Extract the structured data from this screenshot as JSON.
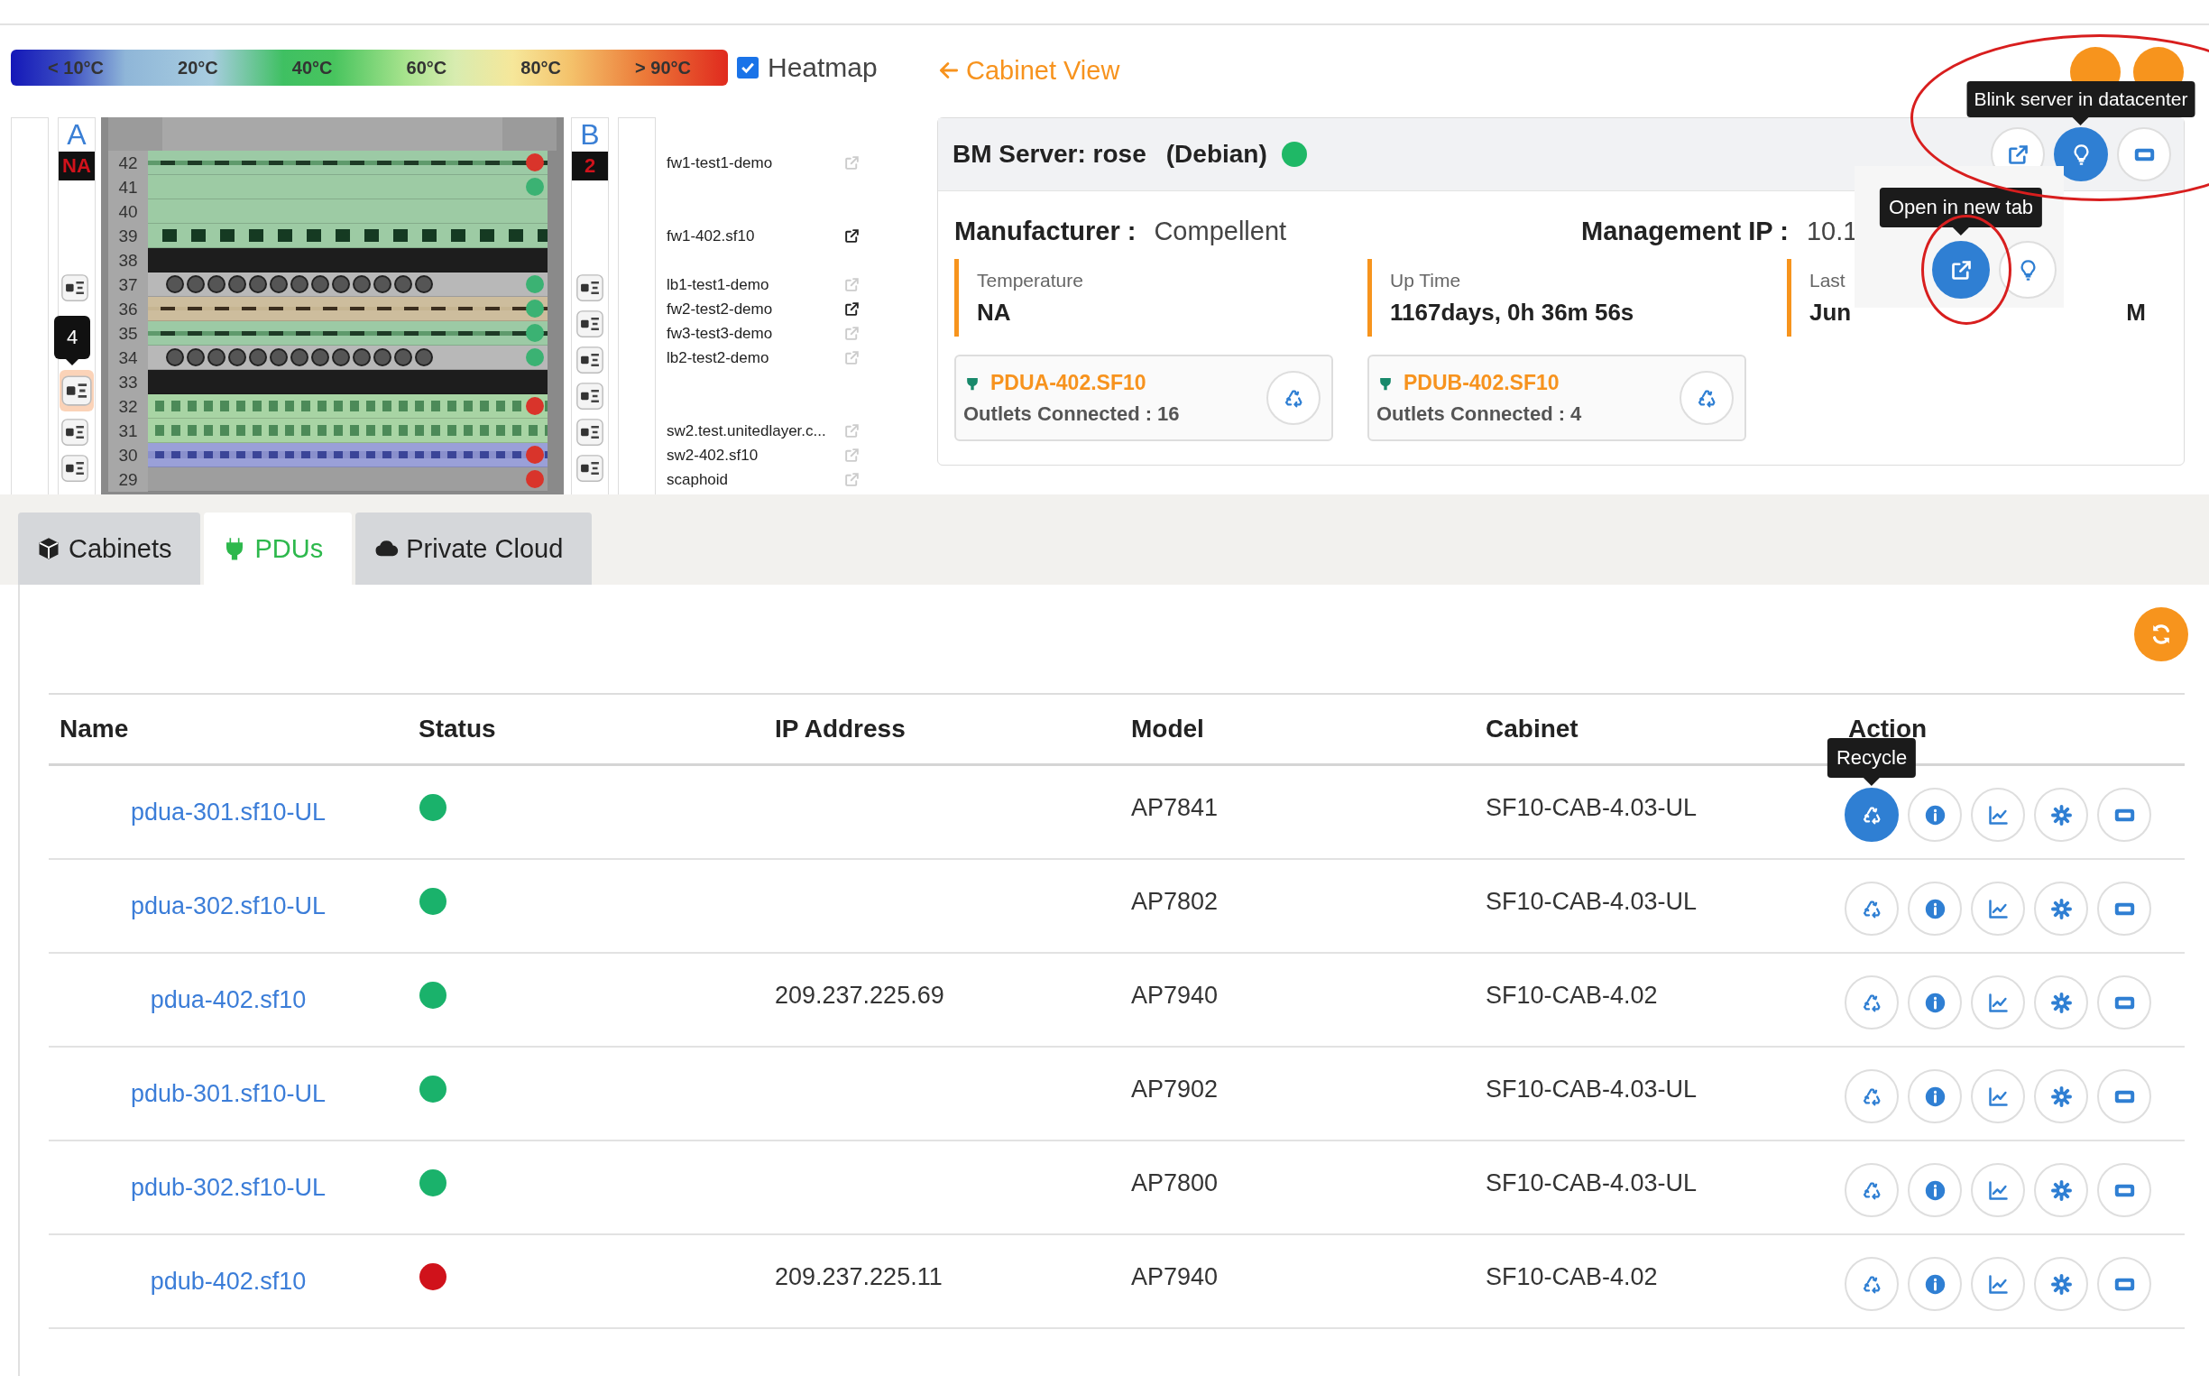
{
  "legend": {
    "labels": [
      "< 10°C",
      "20°C",
      "40°C",
      "60°C",
      "80°C",
      "> 90°C"
    ]
  },
  "heatmap": {
    "label": "Heatmap",
    "checked": true
  },
  "rack": {
    "strips": [
      {
        "label": "A",
        "reading": "NA",
        "outlets": [
          {
            "highlighted": false
          },
          {
            "highlighted": true,
            "badge": "4"
          },
          {
            "highlighted": false
          },
          {
            "highlighted": false
          }
        ]
      },
      {
        "label": "B",
        "reading": "2",
        "outlets": [
          {
            "highlighted": false
          },
          {
            "highlighted": false
          },
          {
            "highlighted": false
          },
          {
            "highlighted": false
          },
          {
            "highlighted": false
          },
          {
            "highlighted": false
          }
        ]
      }
    ],
    "units": [
      {
        "number": "42",
        "kind": "firewall",
        "color": "#d9342b",
        "server": {
          "name": "fw1-test1-demo",
          "link_active": false
        }
      },
      {
        "number": "41",
        "kind": "chassis",
        "color": "#3bb273"
      },
      {
        "number": "40",
        "kind": "chassis"
      },
      {
        "number": "39",
        "kind": "chassis-ports",
        "server": {
          "name": "fw1-402.sf10",
          "link_active": true
        }
      },
      {
        "number": "38",
        "kind": "blank"
      },
      {
        "number": "37",
        "kind": "fan-tray",
        "color": "#3bb273",
        "server": {
          "name": "lb1-test1-demo",
          "link_active": false
        }
      },
      {
        "number": "36",
        "kind": "tan",
        "color": "#3bb273",
        "server": {
          "name": "fw2-test2-demo",
          "link_active": true
        }
      },
      {
        "number": "35",
        "kind": "firewall",
        "color": "#3bb273",
        "server": {
          "name": "fw3-test3-demo",
          "link_active": false
        }
      },
      {
        "number": "34",
        "kind": "fan-tray",
        "color": "#3bb273",
        "server": {
          "name": "lb2-test2-demo",
          "link_active": false
        }
      },
      {
        "number": "33",
        "kind": "blank"
      },
      {
        "number": "32",
        "kind": "switch",
        "color": "#d9342b"
      },
      {
        "number": "31",
        "kind": "switch",
        "server": {
          "name": "sw2.test.unitedlayer.c...",
          "link_active": false
        }
      },
      {
        "number": "30",
        "kind": "patch",
        "color": "#d9342b",
        "server": {
          "name": "sw2-402.sf10",
          "link_active": false
        }
      },
      {
        "number": "29",
        "kind": "gray",
        "color": "#d9342b",
        "server": {
          "name": "scaphoid",
          "link_active": false
        }
      }
    ]
  },
  "detail": {
    "back_link": "Cabinet View",
    "title": "BM Server: rose",
    "os": "(Debian)",
    "color": "#1fb866",
    "header_actions": [
      {
        "kind": "external",
        "active": false
      },
      {
        "kind": "bulb",
        "active": true,
        "tooltip": "Blink server in datacenter"
      },
      {
        "kind": "server",
        "active": false
      }
    ],
    "fields": [
      {
        "label": "Manufacturer :",
        "value": "Compellent"
      },
      {
        "label": "Management IP :",
        "value": "10.1"
      }
    ],
    "stats": [
      {
        "label": "Temperature",
        "value": "NA"
      },
      {
        "label": "Up Time",
        "value": "1167days, 0h 36m 56s"
      },
      {
        "label": "Last",
        "value": "Jun",
        "value_end": "M"
      }
    ],
    "pdus": [
      {
        "name": "PDUA-402.SF10",
        "outlets": "Outlets Connected : 16"
      },
      {
        "name": "PDUB-402.SF10",
        "outlets": "Outlets Connected : 4"
      }
    ],
    "popup": {
      "actions": [
        {
          "kind": "external",
          "active": true,
          "tooltip": "Open in new tab"
        },
        {
          "kind": "bulb",
          "active": false
        }
      ]
    }
  },
  "tabs": [
    {
      "label": "Cabinets",
      "kind": "cube",
      "selected": false
    },
    {
      "label": "PDUs",
      "kind": "plug",
      "selected": true
    },
    {
      "label": "Private Cloud",
      "kind": "cloud",
      "selected": false
    }
  ],
  "table": {
    "columns": [
      "Name",
      "Status",
      "IP Address",
      "Model",
      "Cabinet",
      "Action"
    ],
    "rows": [
      {
        "name": "pdua-301.sf10-UL",
        "color": "#1ab26b",
        "model": "AP7841",
        "cabinet": "SF10-CAB-4.03-UL",
        "actions": [
          {
            "kind": "recycle",
            "active": true,
            "tooltip": "Recycle"
          },
          {
            "kind": "info",
            "active": false
          },
          {
            "kind": "chart",
            "active": false
          },
          {
            "kind": "gear",
            "active": false
          },
          {
            "kind": "server",
            "active": false
          }
        ]
      },
      {
        "name": "pdua-302.sf10-UL",
        "color": "#1ab26b",
        "model": "AP7802",
        "cabinet": "SF10-CAB-4.03-UL",
        "actions": [
          {
            "kind": "recycle",
            "active": false
          },
          {
            "kind": "info",
            "active": false
          },
          {
            "kind": "chart",
            "active": false
          },
          {
            "kind": "gear",
            "active": false
          },
          {
            "kind": "server",
            "active": false
          }
        ]
      },
      {
        "name": "pdua-402.sf10",
        "color": "#1ab26b",
        "ip": "209.237.225.69",
        "model": "AP7940",
        "cabinet": "SF10-CAB-4.02",
        "actions": [
          {
            "kind": "recycle",
            "active": false
          },
          {
            "kind": "info",
            "active": false
          },
          {
            "kind": "chart",
            "active": false
          },
          {
            "kind": "gear",
            "active": false
          },
          {
            "kind": "server",
            "active": false
          }
        ]
      },
      {
        "name": "pdub-301.sf10-UL",
        "color": "#1ab26b",
        "model": "AP7902",
        "cabinet": "SF10-CAB-4.03-UL",
        "actions": [
          {
            "kind": "recycle",
            "active": false
          },
          {
            "kind": "info",
            "active": false
          },
          {
            "kind": "chart",
            "active": false
          },
          {
            "kind": "gear",
            "active": false
          },
          {
            "kind": "server",
            "active": false
          }
        ]
      },
      {
        "name": "pdub-302.sf10-UL",
        "color": "#1ab26b",
        "model": "AP7800",
        "cabinet": "SF10-CAB-4.03-UL",
        "actions": [
          {
            "kind": "recycle",
            "active": false
          },
          {
            "kind": "info",
            "active": false
          },
          {
            "kind": "chart",
            "active": false
          },
          {
            "kind": "gear",
            "active": false
          },
          {
            "kind": "server",
            "active": false
          }
        ]
      },
      {
        "name": "pdub-402.sf10",
        "color": "#d0121b",
        "ip": "209.237.225.11",
        "model": "AP7940",
        "cabinet": "SF10-CAB-4.02",
        "actions": [
          {
            "kind": "recycle",
            "active": false
          },
          {
            "kind": "info",
            "active": false
          },
          {
            "kind": "chart",
            "active": false
          },
          {
            "kind": "gear",
            "active": false
          },
          {
            "kind": "server",
            "active": false
          }
        ]
      }
    ]
  }
}
